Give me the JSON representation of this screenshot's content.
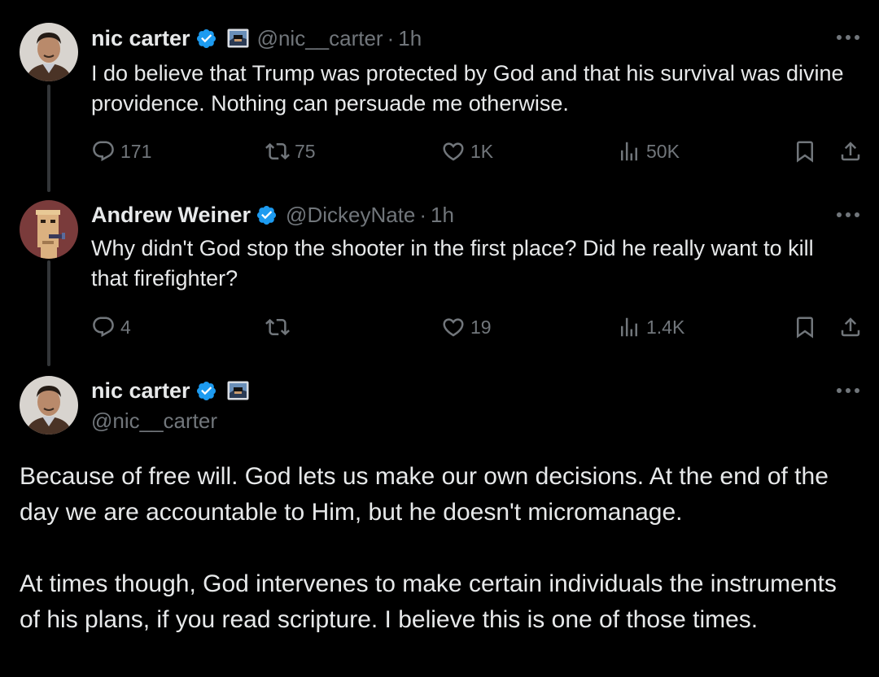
{
  "tweet1": {
    "name": "nic carter",
    "handle": "@nic__carter",
    "sep": "·",
    "time": "1h",
    "text": "I do believe that Trump was protected by God and that his survival was divine providence. Nothing can persuade me otherwise.",
    "replies": "171",
    "reposts": "75",
    "likes": "1K",
    "views": "50K"
  },
  "tweet2": {
    "name": "Andrew Weiner",
    "handle": "@DickeyNate",
    "sep": "·",
    "time": "1h",
    "text": "Why didn't God stop the shooter in the first place? Did he really want to kill that firefighter?",
    "replies": "4",
    "reposts": "",
    "likes": "19",
    "views": "1.4K"
  },
  "tweet3": {
    "name": "nic carter",
    "handle": "@nic__carter",
    "paragraph1": "Because of free will. God lets us make our own decisions. At the end of the day we are accountable to Him, but he doesn't micromanage.",
    "paragraph2": "At times though, God intervenes to make certain individuals the instruments of his plans, if you read scripture. I believe this is one of those times."
  },
  "colors": {
    "background": "#000000",
    "text": "#e7e9ea",
    "muted": "#71767b",
    "verified": "#1d9bf0"
  },
  "icons": [
    "verified-badge-icon",
    "affiliate-badge-icon",
    "more-icon",
    "reply-icon",
    "repost-icon",
    "like-icon",
    "views-icon",
    "bookmark-icon",
    "share-icon"
  ]
}
